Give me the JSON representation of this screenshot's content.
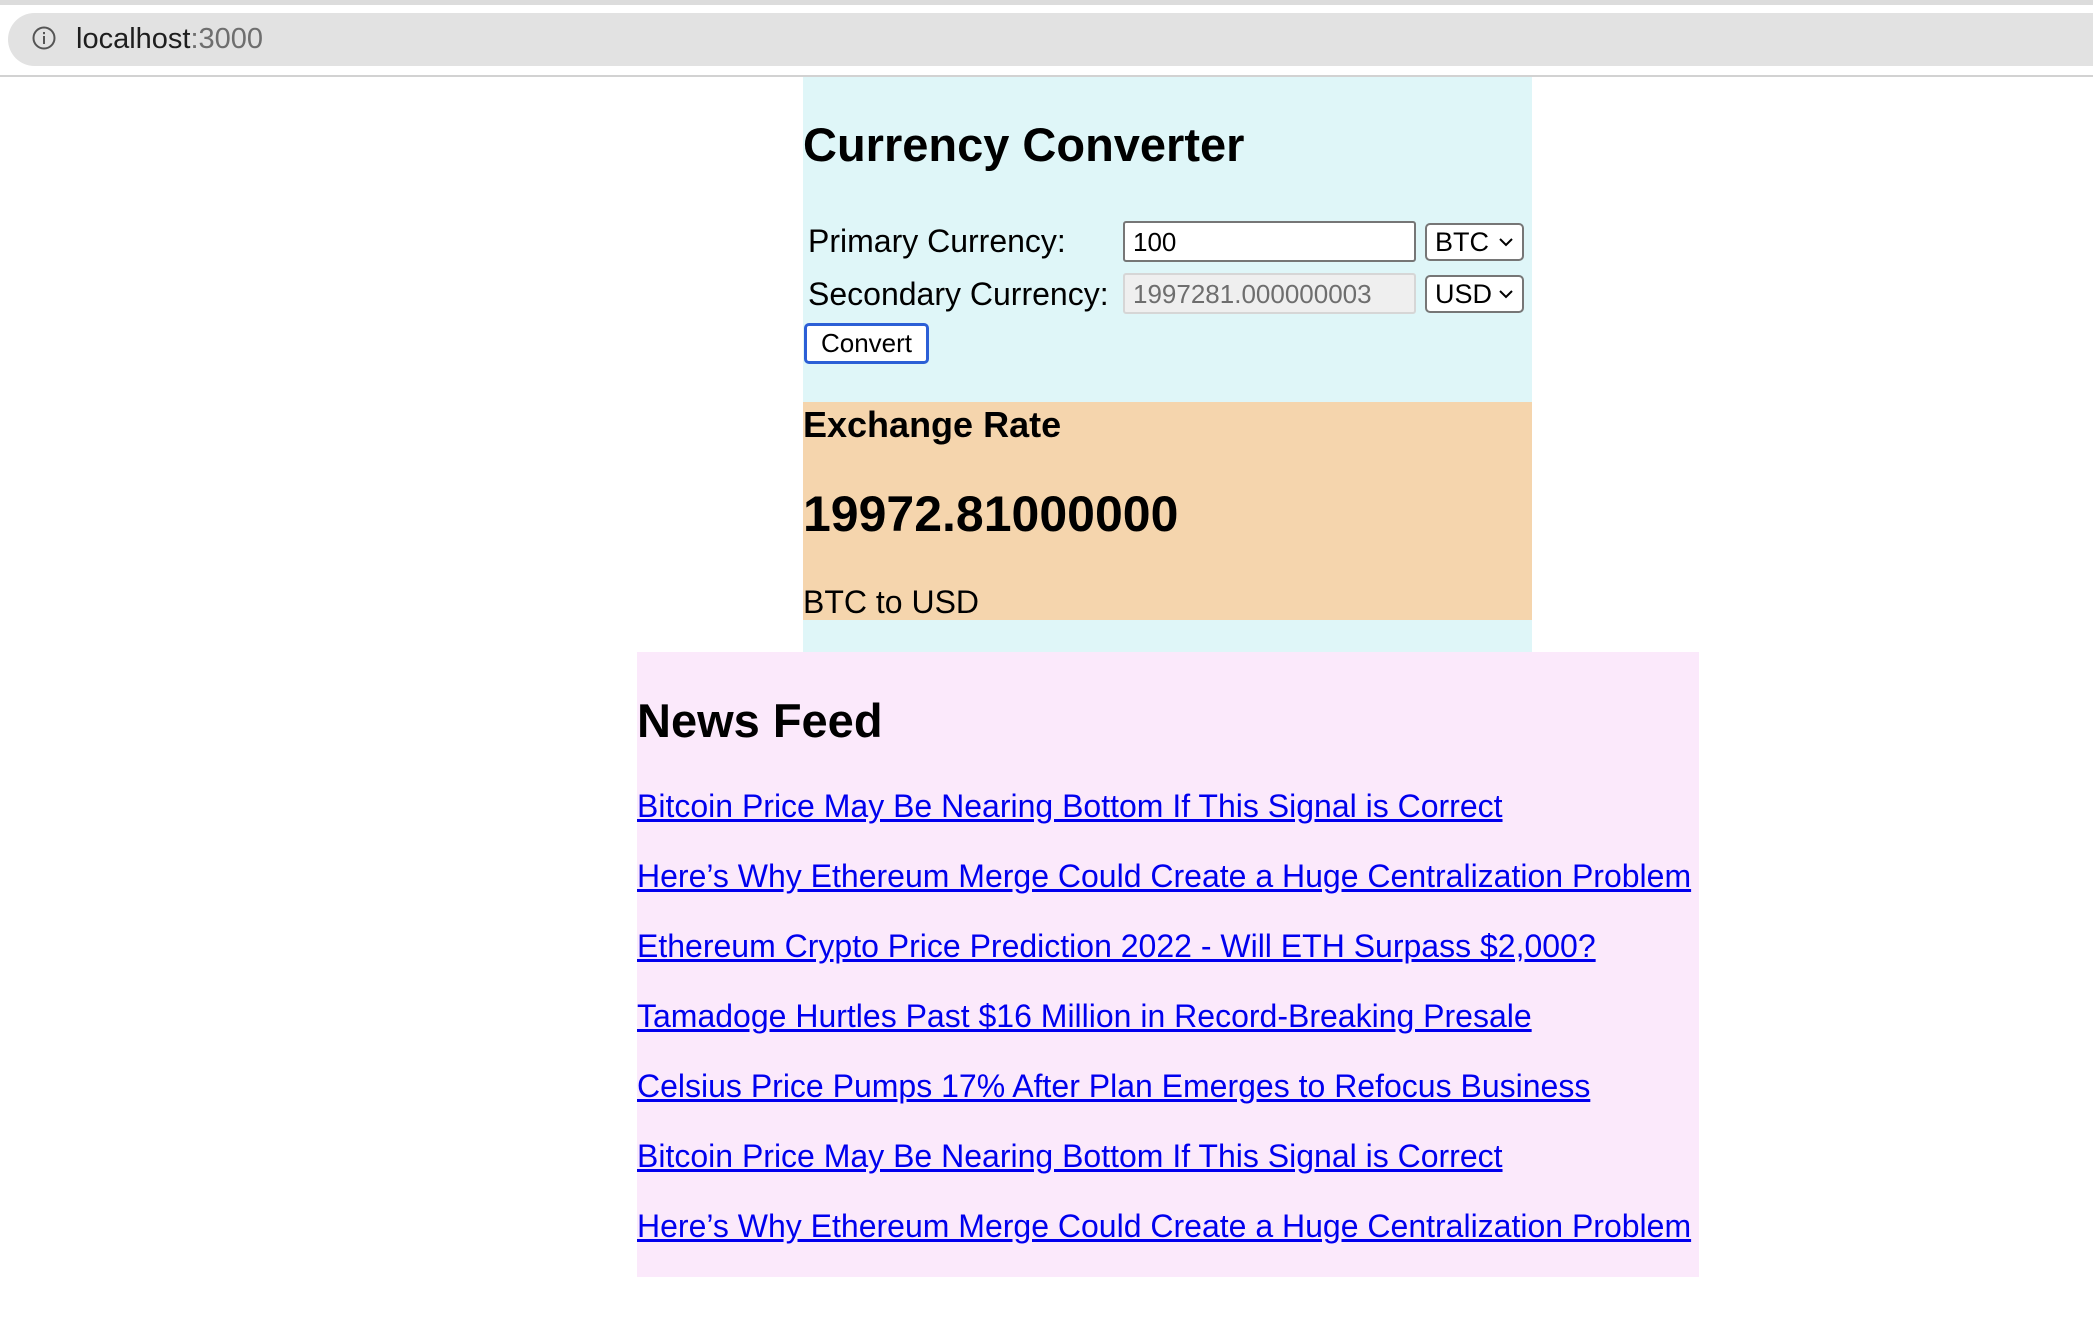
{
  "browser": {
    "url_host": "localhost",
    "url_port": ":3000",
    "info_icon": "info-icon"
  },
  "converter": {
    "title": "Currency Converter",
    "primary_label": "Primary Currency:",
    "primary_value": "100",
    "primary_currency": "BTC",
    "secondary_label": "Secondary Currency:",
    "secondary_value": "1997281.000000003",
    "secondary_currency": "USD",
    "convert_label": "Convert"
  },
  "exchange_rate": {
    "heading": "Exchange Rate",
    "value": "19972.81000000",
    "pair": "BTC to USD"
  },
  "news": {
    "title": "News Feed",
    "items": [
      "Bitcoin Price May Be Nearing Bottom If This Signal is Correct",
      "Here’s Why Ethereum Merge Could Create a Huge Centralization Problem",
      "Ethereum Crypto Price Prediction 2022 - Will ETH Surpass $2,000?",
      "Tamadoge Hurtles Past $16 Million in Record-Breaking Presale",
      "Celsius Price Pumps 17% After Plan Emerges to Refocus Business",
      "Bitcoin Price May Be Nearing Bottom If This Signal is Correct",
      "Here’s Why Ethereum Merge Could Create a Huge Centralization Problem"
    ]
  },
  "colors": {
    "converter_bg": "#dff6f8",
    "rate_bg": "#f5d5ad",
    "news_bg": "#fbe9fb",
    "link": "#0000ee",
    "focus_ring": "#2b5fd6"
  }
}
